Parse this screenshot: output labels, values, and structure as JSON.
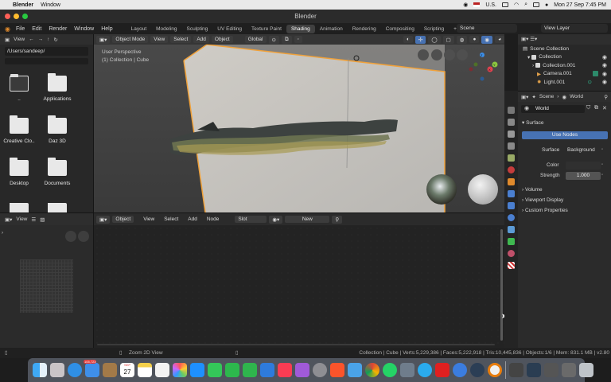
{
  "menubar": {
    "app": "Blender",
    "window": "Window",
    "input_source": "U.S.",
    "datetime": "Mon 27 Sep  7:45 PM"
  },
  "titlebar": {
    "title": "Blender"
  },
  "topmenu": {
    "items": [
      "File",
      "Edit",
      "Render",
      "Window",
      "Help"
    ],
    "workspaces": [
      "Layout",
      "Modeling",
      "Sculpting",
      "UV Editing",
      "Texture Paint",
      "Shading",
      "Animation",
      "Rendering",
      "Compositing",
      "Scripting"
    ],
    "active_workspace": "Shading",
    "add_tab": "+",
    "scene": "Scene",
    "view_layer": "View Layer"
  },
  "filebrowser": {
    "view_label": "View",
    "path": "/Users/sandeep/",
    "folders": [
      "..",
      "Applications",
      "Creative Clo..",
      "Daz 3D",
      "Desktop",
      "Documents"
    ]
  },
  "viewport": {
    "mode": "Object Mode",
    "menus": [
      "View",
      "Select",
      "Add",
      "Object"
    ],
    "transform": "Global",
    "info_line1": "User Perspective",
    "info_line2": "(1) Collection | Cube",
    "gizmo": {
      "x": "X",
      "y": "Y",
      "z": "Z"
    }
  },
  "imgpanel": {
    "view_label": "View"
  },
  "nodeeditor": {
    "object_label": "Object",
    "menus": [
      "View",
      "Select",
      "Add",
      "Node"
    ],
    "slot": "Slot",
    "new_button": "New"
  },
  "outliner": {
    "rows": [
      "Scene Collection",
      "Collection",
      "Collection.001",
      "Camera.001",
      "Light.001"
    ]
  },
  "properties": {
    "scene_tab": "Scene",
    "world_tab": "World",
    "world_name": "World",
    "surface_header": "Surface",
    "use_nodes": "Use Nodes",
    "surface_label": "Surface",
    "surface_value": "Background",
    "color_label": "Color",
    "strength_label": "Strength",
    "strength_value": "1.000",
    "volume": "Volume",
    "viewport_display": "Viewport Display",
    "custom_properties": "Custom Properties"
  },
  "statusbar": {
    "hint": "Zoom 2D View",
    "stats": "Collection | Cube | Verts:5,229,386 | Faces:5,222,918 | Tris:10,445,836 | Objects:1/6 | Mem: 831.1 MB | v2.80"
  },
  "dock": {
    "calendar_month": "SEP",
    "calendar_day": "27",
    "mail_badge": "105,723"
  },
  "colors": {
    "accent": "#4772b3",
    "active_workspace": "#404040",
    "blender_orange": "#e08a2c"
  }
}
